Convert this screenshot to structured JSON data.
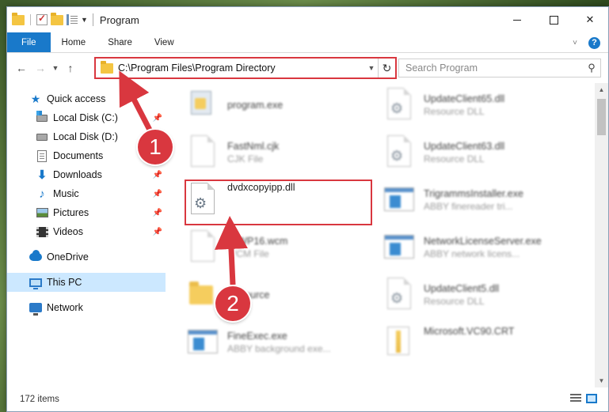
{
  "window": {
    "title": "Program"
  },
  "ribbon": {
    "tabs": [
      "File",
      "Home",
      "Share",
      "View"
    ]
  },
  "address": {
    "path": "C:\\Program Files\\Program Directory"
  },
  "search": {
    "placeholder": "Search Program"
  },
  "nav": {
    "quick_access": "Quick access",
    "items": [
      {
        "label": "Local Disk (C:)",
        "icon": "local-disk-c-icon",
        "pinned": true
      },
      {
        "label": "Local Disk (D:)",
        "icon": "local-disk-d-icon",
        "pinned": false
      },
      {
        "label": "Documents",
        "icon": "documents-icon",
        "pinned": true
      },
      {
        "label": "Downloads",
        "icon": "downloads-icon",
        "pinned": true
      },
      {
        "label": "Music",
        "icon": "music-icon",
        "pinned": true
      },
      {
        "label": "Pictures",
        "icon": "pictures-icon",
        "pinned": true
      },
      {
        "label": "Videos",
        "icon": "videos-icon",
        "pinned": true
      }
    ],
    "onedrive": "OneDrive",
    "this_pc": "This PC",
    "network": "Network"
  },
  "files": {
    "col1": [
      {
        "name": "program.exe",
        "type": ""
      },
      {
        "name": "FastNml.cjk",
        "type": "CJK File"
      },
      {
        "name": "dvdxcopyipp.dll",
        "type": ""
      },
      {
        "name": "ToWP16.wcm",
        "type": "WCM File"
      },
      {
        "name": "Resource",
        "type": ""
      },
      {
        "name": "FineExec.exe",
        "type": "ABBY background exe..."
      }
    ],
    "col2": [
      {
        "name": "UpdateClient65.dll",
        "type": "Resource DLL"
      },
      {
        "name": "UpdateClient63.dll",
        "type": "Resource DLL"
      },
      {
        "name": "TrigrammsInstaller.exe",
        "type": "ABBY finereader tri..."
      },
      {
        "name": "NetworkLicenseServer.exe",
        "type": "ABBY network licens..."
      },
      {
        "name": "UpdateClient5.dll",
        "type": "Resource DLL"
      },
      {
        "name": "Microsoft.VC90.CRT",
        "type": ""
      }
    ]
  },
  "status": {
    "item_count": "172 items"
  },
  "annotations": {
    "badge1": "1",
    "badge2": "2"
  },
  "colors": {
    "accent": "#1979ca",
    "highlight": "#d9373f",
    "selection": "#cce8ff"
  }
}
